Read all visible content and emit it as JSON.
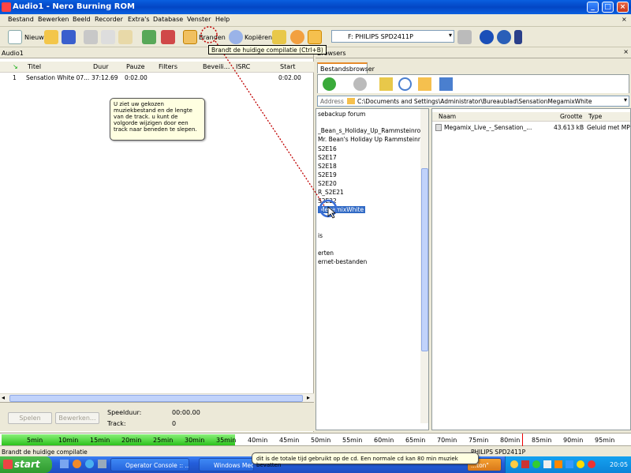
{
  "window": {
    "title": "Audio1 - Nero Burning ROM",
    "inner_close": "×"
  },
  "menu": [
    "Bestand",
    "Bewerken",
    "Beeld",
    "Recorder",
    "Extra's",
    "Database",
    "Venster",
    "Help"
  ],
  "toolbar": {
    "new_label": "Nieuw",
    "burn_label": "Branden",
    "copy_label": "Kopiëren",
    "drive_select": "F: PHILIPS SPD2411P",
    "burn_tooltip": "Brandt de huidige compilatie (Ctrl+B)"
  },
  "compilation": {
    "pane_title": "Audio1",
    "columns": [
      "Titel",
      "Duur",
      "Pauze",
      "Filters",
      "Beveili...",
      "ISRC",
      "Start"
    ],
    "tracks": [
      {
        "num": "1",
        "title": "Sensation White 07...",
        "duration": "37:12.69",
        "pause": "0:02.00",
        "start": "0:02.00"
      }
    ],
    "help_bubble": "U ziet uw gekozen muziekbestand en de lengte van de track. u kunt de volgorde wijzigen door een track naar beneden te slepen.",
    "play_button": "Spelen",
    "edit_button": "Bewerken...",
    "play_duration_label": "Speelduur:",
    "play_duration_value": "00:00.00",
    "track_label": "Track:",
    "track_value": "0"
  },
  "browser": {
    "pane_title": "Browsers",
    "close": "×",
    "tab": "Bestandsbrowser",
    "address_label": "Address",
    "address_value": "C:\\Documents and Settings\\Administrator\\Bureaublad\\SensationMegamixWhite",
    "folders": [
      "sebackup forum",
      "_Bean_s_Holiday_Up_Rammsteinrock_",
      "Mr. Bean's Holiday Up Rammsteinrock",
      "S2E16",
      "S2E17",
      "S2E18",
      "S2E19",
      "S2E20",
      "R_S2E21",
      "S2E22",
      "SensationMegamixWhite",
      "is",
      "erten",
      "ernet-bestanden"
    ],
    "selected_folder_display": "MegamixWhite",
    "file_columns": [
      "Naam",
      "Grootte",
      "Type"
    ],
    "files": [
      {
        "name": "Megamix_Live_-_Sensation_...",
        "size": "43.613 kB",
        "type": "Geluid met MP3"
      }
    ]
  },
  "timeline": {
    "ticks": [
      "5min",
      "10min",
      "15min",
      "20min",
      "25min",
      "30min",
      "35min",
      "40min",
      "45min",
      "50min",
      "55min",
      "60min",
      "65min",
      "70min",
      "75min",
      "80min",
      "85min",
      "90min",
      "95min"
    ],
    "used_fraction": 0.372,
    "info_bubble": "dit is de totale tijd gebruikt op de cd. Een normale cd kan 80 min muziek bevatten"
  },
  "status": {
    "left": "Brandt de huidige compilatie",
    "right": "PHILIPS  SPD2411P"
  },
  "taskbar": {
    "start": "start",
    "items": [
      "Operator Console :: ...",
      "Windows Media..."
    ],
    "hidden_item": "...ton\"",
    "clock": "20:05"
  },
  "colors": {
    "titlebar": "#0a5fe0",
    "timeline_fill": "#2bc21b",
    "selection": "#316ac5",
    "dotted_annotation": "#c00000"
  }
}
